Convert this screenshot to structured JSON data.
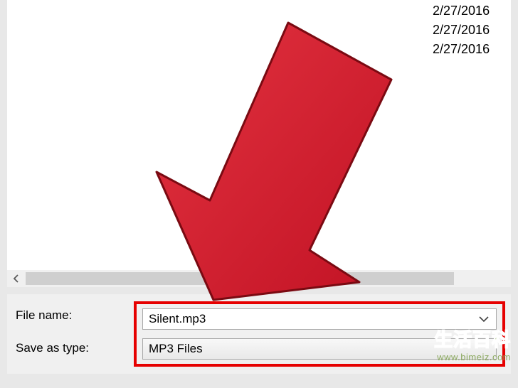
{
  "file_list": {
    "dates": [
      "2/27/2016",
      "2/27/2016",
      "2/27/2016"
    ]
  },
  "form": {
    "file_name_label": "File name:",
    "file_name_value": "Silent.mp3",
    "save_as_type_label": "Save as type:",
    "save_as_type_value": "MP3 Files"
  },
  "watermark": {
    "text": "生活百科",
    "url": "www.bimeiz.com"
  }
}
